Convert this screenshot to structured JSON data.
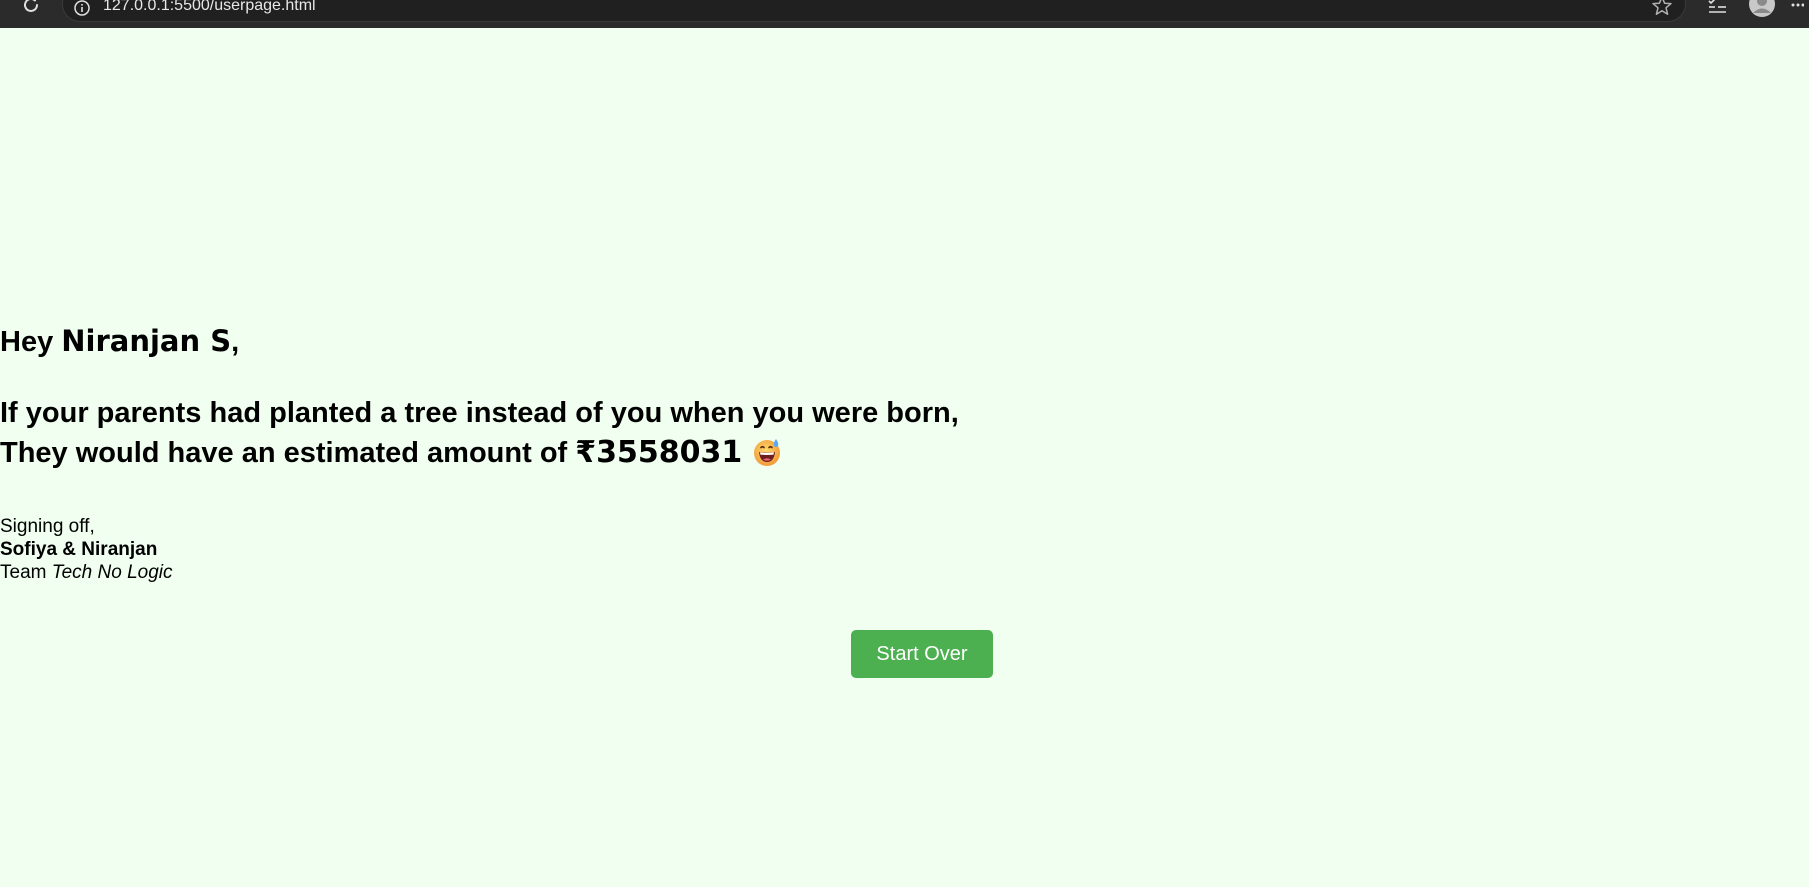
{
  "browser": {
    "url": "127.0.0.1:5500/userpage.html"
  },
  "page": {
    "background_color": "#f0fff0",
    "greeting_prefix": "Hey ",
    "user_name": "Niranjan S",
    "greeting_suffix": ",",
    "line1": "If your parents had planted a tree instead of you when you were born,",
    "line2_prefix": "They would have an estimated amount of ",
    "amount": "₹3558031",
    "emoji": "grinning-sweat-emoji",
    "signoff_label": "Signing off,",
    "authors": "Sofiya & Niranjan",
    "team_prefix": "Team ",
    "team_name": "Tech No Logic",
    "button_label": "Start Over",
    "button_color": "#4caf50"
  }
}
